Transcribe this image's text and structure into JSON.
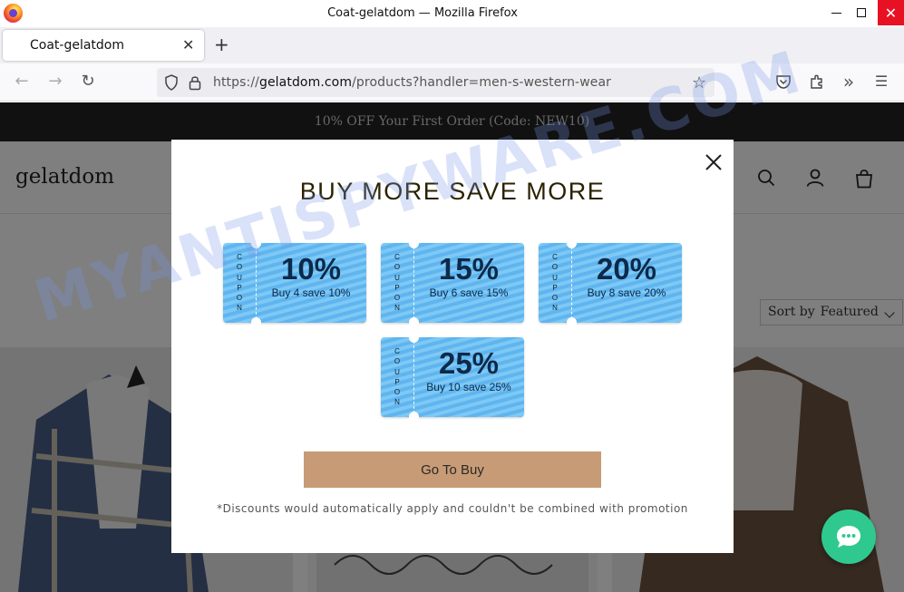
{
  "window": {
    "title": "Coat-gelatdom — Mozilla Firefox",
    "close_glyph": "✕"
  },
  "tabs": [
    {
      "label": "Coat-gelatdom",
      "close_glyph": "✕"
    }
  ],
  "tabstrip": {
    "new_tab_glyph": "+"
  },
  "navbar": {
    "back_glyph": "←",
    "forward_glyph": "→",
    "reload_glyph": "↻",
    "url_prefix": "https://",
    "url_domain": "gelatdom.com",
    "url_path": "/products?handler=men-s-western-wear",
    "star_glyph": "☆",
    "overflow_glyph": "»",
    "menu_glyph": "☰"
  },
  "page": {
    "promo_text": "10% OFF Your First Order (Code: NEW10)",
    "shop_logo": "gelatdom",
    "sort_label": "Sort by",
    "sort_value": "Featured"
  },
  "modal": {
    "close_glyph": "✕",
    "title": "BUY MORE SAVE MORE",
    "coupon_side_text": "COUPON",
    "coupons": [
      {
        "percent": "10%",
        "description": "Buy 4 save 10%"
      },
      {
        "percent": "15%",
        "description": "Buy 6 save 15%"
      },
      {
        "percent": "20%",
        "description": "Buy 8 save 20%"
      },
      {
        "percent": "25%",
        "description": "Buy 10 save 25%"
      }
    ],
    "button_label": "Go To Buy",
    "disclaimer": "*Discounts would automatically apply and couldn't be combined with promotion"
  },
  "watermark": "MYANTISPYWARE.COM",
  "colors": {
    "promo_bar": "#222222",
    "coupon_blue": "#6dbdf2",
    "button": "#c79b75",
    "chat": "#2fc98f",
    "close": "#e81123"
  },
  "icons": [
    "firefox-icon",
    "back-icon",
    "forward-icon",
    "reload-icon",
    "shield-icon",
    "lock-icon",
    "star-icon",
    "pocket-icon",
    "extensions-icon",
    "overflow-icon",
    "menu-icon",
    "search-icon",
    "account-icon",
    "cart-icon",
    "close-icon",
    "chat-icon"
  ]
}
